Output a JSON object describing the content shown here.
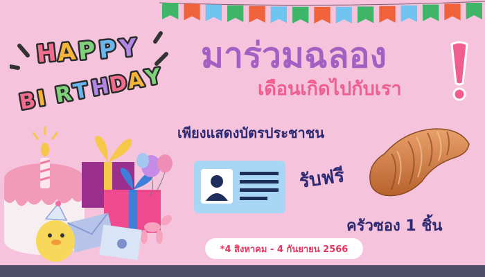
{
  "sticker": {
    "word1": "HAPPY",
    "word2": "BIRTHDAY",
    "letter_colors": [
      "#f26d8d",
      "#f5b43c",
      "#7fd27b",
      "#6ab7f0",
      "#b386e6"
    ]
  },
  "headline": "มาร่วมฉลอง",
  "subheadline": "เดือนเกิดไปกับเรา",
  "condition": "เพียงแสดงบัตรประชาชน",
  "free_label": "รับฟรี",
  "reward": "ครัวซอง 1 ชิ้น",
  "date_note": "*4 สิงหาคม - 4 กันยายน 2566",
  "colors": {
    "background": "#f6c3dd",
    "headline": "#a35fc1",
    "subheadline": "#ef5e8e",
    "navy": "#2d2a73",
    "accent_red": "#e8325d",
    "id_card": "#a8d6f5",
    "bottom_bar": "#4e4e6b"
  },
  "flag_colors": [
    "#3fb56a",
    "#f0623a",
    "#6fc4f0",
    "#3fb56a",
    "#f0623a",
    "#6fc4f0",
    "#3fb56a",
    "#f0623a",
    "#6fc4f0",
    "#3fb56a",
    "#f0623a",
    "#6fc4f0",
    "#3fb56a",
    "#f0623a",
    "#3fb56a"
  ],
  "icons": {
    "id_card": "id-card-icon",
    "croissant": "croissant-icon",
    "cake": "birthday-cake-icon",
    "gifts": "gift-box-icon",
    "balloons": "balloon-icon",
    "duck": "duck-icon",
    "envelope": "envelope-icon"
  }
}
